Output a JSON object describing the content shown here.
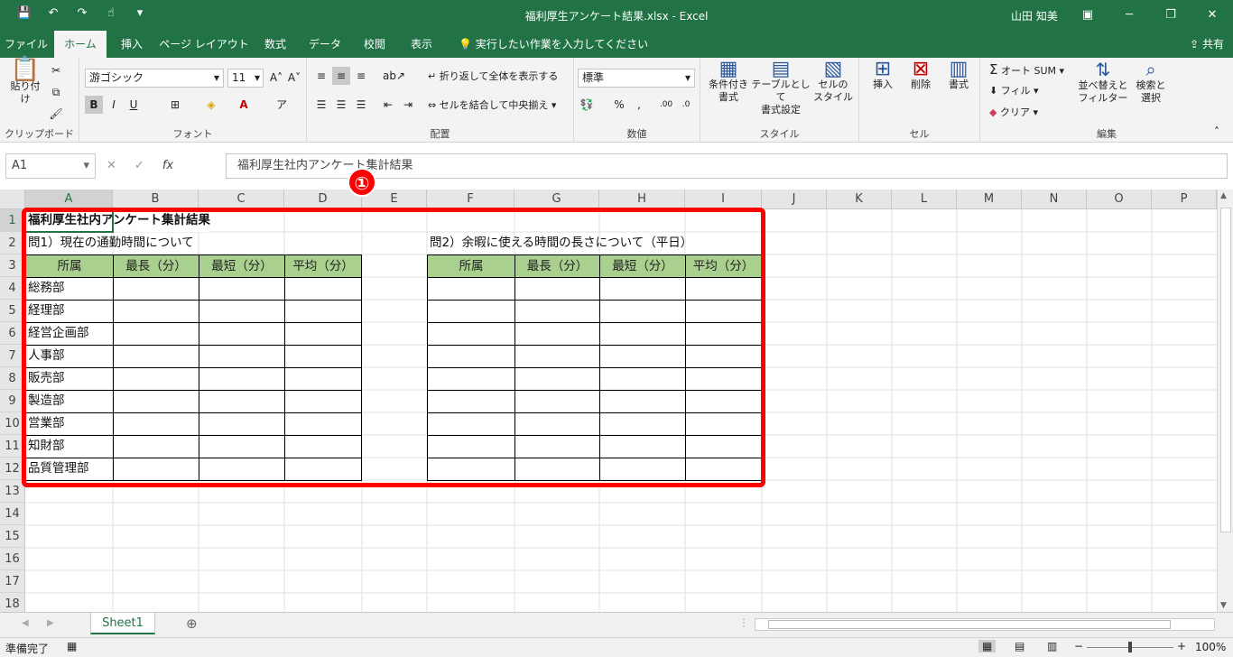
{
  "app": {
    "window_title": "福利厚生アンケート結果.xlsx - Excel",
    "user_name": "山田 知美"
  },
  "colors": {
    "brand": "#217346",
    "header_fill": "#a9d08e",
    "highlight": "#ff0000"
  },
  "tabs": [
    "ファイル",
    "ホーム",
    "挿入",
    "ページ レイアウト",
    "数式",
    "データ",
    "校閲",
    "表示"
  ],
  "tell_me": "実行したい作業を入力してください",
  "share": "共有",
  "ribbon": {
    "clipboard": {
      "label": "クリップボード",
      "paste": "貼り付け"
    },
    "font": {
      "label": "フォント",
      "font_name": "游ゴシック",
      "font_size": "11",
      "bold": "B",
      "italic": "I",
      "underline": "U"
    },
    "alignment": {
      "label": "配置",
      "wrap_text": "折り返して全体を表示する",
      "merge_center": "セルを結合して中央揃え"
    },
    "number": {
      "label": "数値",
      "format": "標準"
    },
    "styles": {
      "label": "スタイル",
      "conditional_1": "条件付き",
      "conditional_2": "書式",
      "table_1": "テーブルとして",
      "table_2": "書式設定",
      "cell_1": "セルの",
      "cell_2": "スタイル"
    },
    "cells": {
      "label": "セル",
      "insert": "挿入",
      "delete": "削除",
      "format": "書式"
    },
    "editing": {
      "label": "編集",
      "autosum": "オート SUM",
      "fill": "フィル",
      "clear": "クリア",
      "sort_1": "並べ替えと",
      "sort_2": "フィルター",
      "find_1": "検索と",
      "find_2": "選択"
    }
  },
  "formula_bar": {
    "name_box": "A1",
    "fx": "fx",
    "content": "福利厚生社内アンケート集計結果"
  },
  "grid": {
    "columns": [
      "A",
      "B",
      "C",
      "D",
      "E",
      "F",
      "G",
      "H",
      "I",
      "J",
      "K",
      "L",
      "M",
      "N",
      "O",
      "P"
    ],
    "rows": [
      "1",
      "2",
      "3",
      "4",
      "5",
      "6",
      "7",
      "8",
      "9",
      "10",
      "11",
      "12",
      "13",
      "14",
      "15",
      "16",
      "17",
      "18"
    ],
    "title": "福利厚生社内アンケート集計結果",
    "q1": "問1）現在の通勤時間について",
    "q2": "問2）余暇に使える時間の長さについて（平日）",
    "table_headers": [
      "所属",
      "最長（分）",
      "最短（分）",
      "平均（分）"
    ],
    "departments": [
      "総務部",
      "経理部",
      "経営企画部",
      "人事部",
      "販売部",
      "製造部",
      "営業部",
      "知財部",
      "品質管理部"
    ]
  },
  "annotation": {
    "badge": "①"
  },
  "sheet_tab": "Sheet1",
  "status": {
    "ready": "準備完了",
    "zoom": "100%"
  }
}
